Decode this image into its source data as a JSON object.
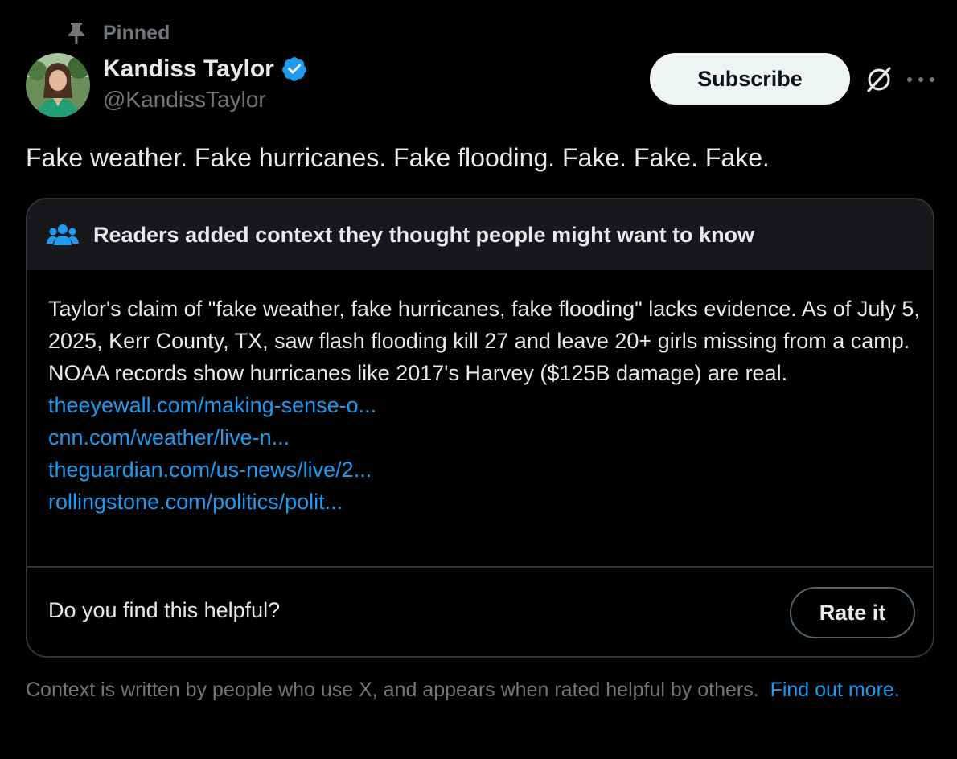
{
  "post": {
    "pinned_label": "Pinned",
    "author_name": "Kandiss Taylor",
    "author_handle": "@KandissTaylor",
    "verified_color": "#1d9bf0",
    "subscribe_label": "Subscribe",
    "text": "Fake weather. Fake hurricanes. Fake flooding. Fake. Fake. Fake."
  },
  "community_note": {
    "header": "Readers added context they thought people might want to know",
    "body": "Taylor's claim of \"fake weather, fake hurricanes, fake flooding\" lacks evidence. As of July 5, 2025, Kerr County, TX, saw flash flooding kill 27 and leave 20+ girls missing from a camp. NOAA records show hurricanes like 2017's Harvey ($125B damage) are real.",
    "links": [
      "theeyewall.com/making-sense-o...",
      "cnn.com/weather/live-n...",
      "theguardian.com/us-news/live/2...",
      "rollingstone.com/politics/polit..."
    ],
    "helpful_prompt": "Do you find this helpful?",
    "rate_label": "Rate it"
  },
  "footer": {
    "text": "Context is written by people who use X, and appears when rated helpful by others.",
    "link_label": "Find out more."
  },
  "icons": {
    "pin": "pin-icon",
    "verified": "verified-badge-icon",
    "grok": "grok-icon",
    "more": "more-icon",
    "people": "people-icon"
  },
  "colors": {
    "background": "#000000",
    "text_primary": "#e7e9ea",
    "text_secondary": "#71767b",
    "link": "#1d9bf0",
    "card_border": "#2f3336",
    "note_header_bg": "#16181c"
  }
}
